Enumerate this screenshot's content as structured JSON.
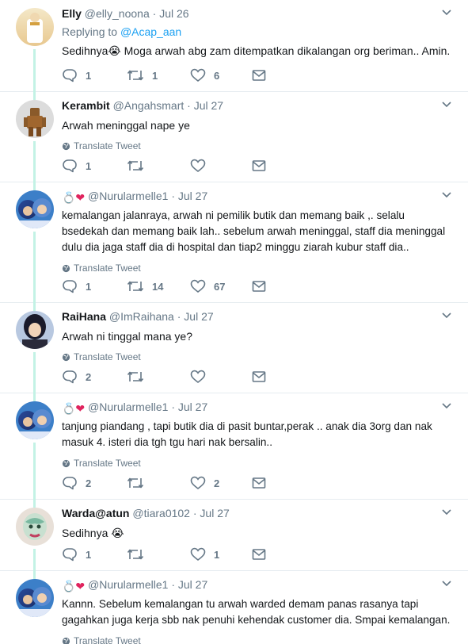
{
  "colors": {
    "link": "#1da1f2",
    "muted": "#657786",
    "thread": "#c3f2e5",
    "heart": "#e0245e"
  },
  "tweets": [
    {
      "name": "Elly",
      "handle": "@elly_noona",
      "time": "Jul 26",
      "reply_prefix": "Replying to",
      "reply_to": "@Acap_aan",
      "text": "Sedihnya😭 Moga arwah abg zam ditempatkan dikalangan org beriman.. Amin.",
      "replies": "1",
      "retweets": "1",
      "likes": "6"
    },
    {
      "name": "Kerambit",
      "handle": "@Angahsmart",
      "time": "Jul 27",
      "text": "Arwah meninggal nape ye",
      "translate": "Translate Tweet",
      "replies": "1",
      "retweets": "",
      "likes": ""
    },
    {
      "name_emoji": "💍❤",
      "handle": "@Nurularmelle1",
      "time": "Jul 27",
      "text": "kemalangan jalanraya, arwah ni pemilik butik dan memang baik ,. selalu bsedekah dan memang baik lah..  sebelum arwah meninggal, staff dia meninggal dulu dia jaga staff dia di hospital dan tiap2 minggu ziarah kubur staff dia..",
      "translate": "Translate Tweet",
      "replies": "1",
      "retweets": "14",
      "likes": "67"
    },
    {
      "name": "RaiHana",
      "handle": "@ImRaihana",
      "time": "Jul 27",
      "text": "Arwah ni tinggal mana ye?",
      "translate": "Translate Tweet",
      "replies": "2",
      "retweets": "",
      "likes": ""
    },
    {
      "name_emoji": "💍❤",
      "handle": "@Nurularmelle1",
      "time": "Jul 27",
      "text": "tanjung piandang , tapi butik dia di pasit buntar,perak .. anak dia 3org dan nak masuk 4. isteri dia tgh tgu hari nak bersalin..",
      "translate": "Translate Tweet",
      "replies": "2",
      "retweets": "",
      "likes": "2"
    },
    {
      "name": "Warda@atun",
      "handle": "@tiara0102",
      "time": "Jul 27",
      "text": "Sedihnya 😭",
      "replies": "1",
      "retweets": "",
      "likes": "1"
    },
    {
      "name_emoji": "💍❤",
      "handle": "@Nurularmelle1",
      "time": "Jul 27",
      "text": "Kannn. Sebelum kemalangan tu arwah warded demam panas rasanya tapi gagahkan juga kerja sbb nak penuhi kehendak customer dia. Smpai kemalangan.",
      "translate": "Translate Tweet"
    }
  ]
}
